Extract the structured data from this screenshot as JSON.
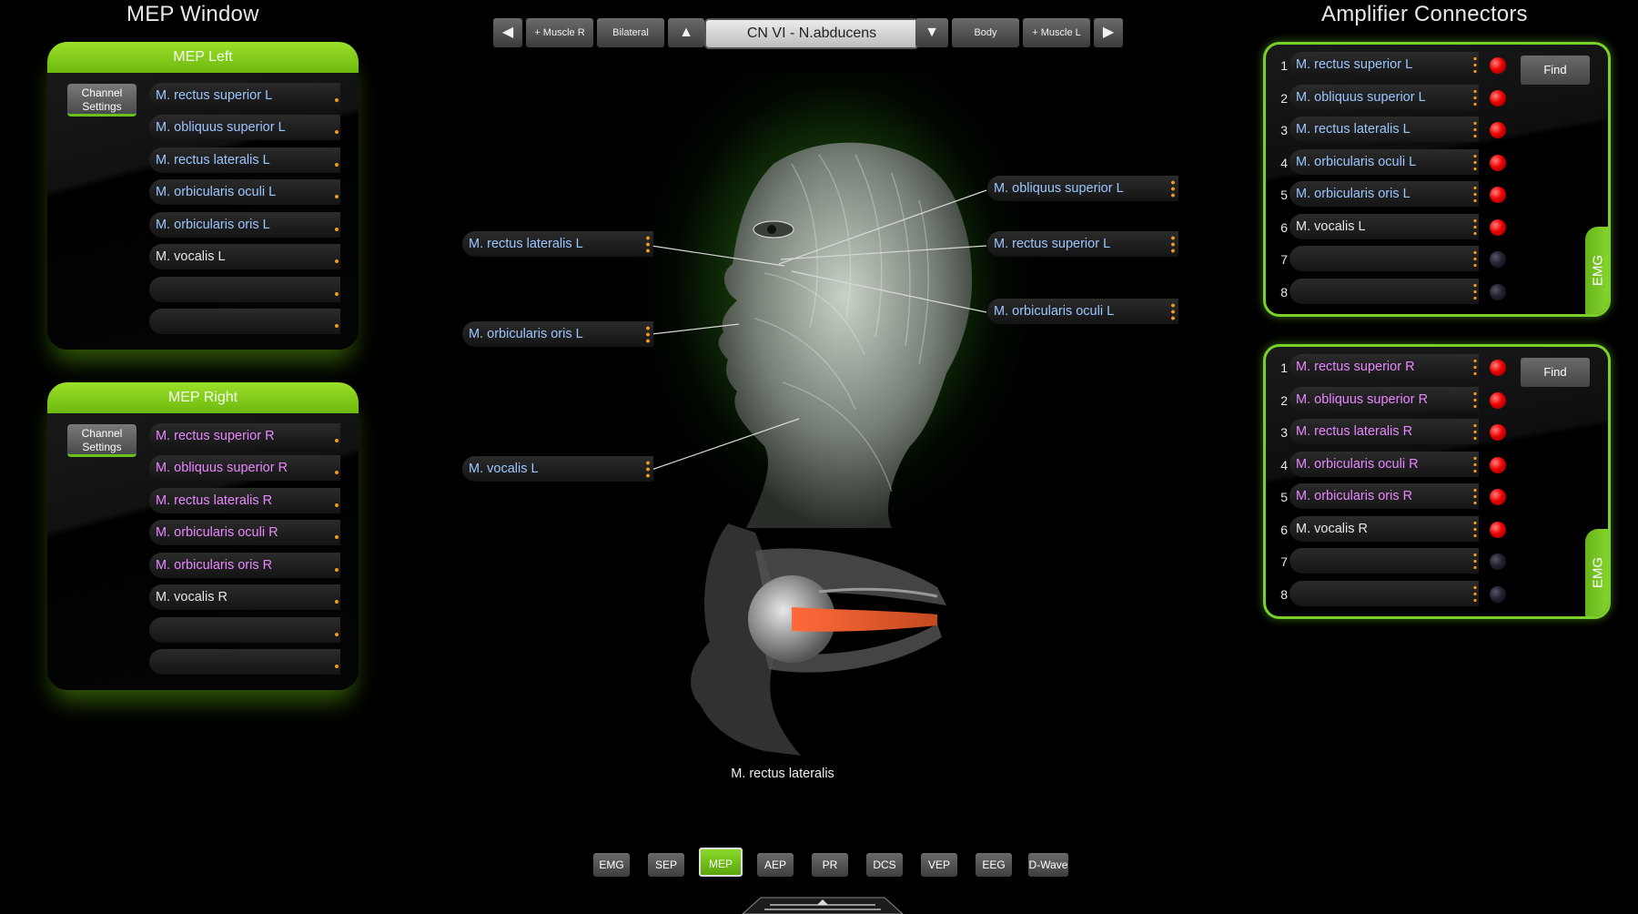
{
  "titles": {
    "mep_window": "MEP Window",
    "amplifier": "Amplifier Connectors"
  },
  "mep_left": {
    "header": "MEP Left",
    "channel_settings": "Channel Settings",
    "channels": [
      "M. rectus superior L",
      "M. obliquus superior L",
      "M. rectus lateralis L",
      "M. orbicularis oculi L",
      "M. orbicularis oris L",
      "M. vocalis L",
      "",
      ""
    ]
  },
  "mep_right": {
    "header": "MEP Right",
    "channel_settings": "Channel Settings",
    "channels": [
      "M. rectus superior R",
      "M. obliquus superior R",
      "M. rectus lateralis R",
      "M. orbicularis oculi R",
      "M. orbicularis oris R",
      "M. vocalis R",
      "",
      ""
    ]
  },
  "toolbar": {
    "prev_arrow": "◀",
    "muscle_r": "+ Muscle R",
    "bilateral": "Bilateral",
    "up_arrow": "▲",
    "nerve_select": "CN VI - N.abducens",
    "down_arrow": "▼",
    "body": "Body",
    "muscle_l": "+ Muscle L",
    "next_arrow": "▶"
  },
  "canvas": {
    "labels": {
      "rectus_lateralis": "M. rectus lateralis L",
      "orbicularis_oris": "M. orbicularis oris L",
      "vocalis": "M. vocalis L",
      "obliquus_superior": "M. obliquus superior L",
      "rectus_superior": "M. rectus superior L",
      "orbicularis_oculi": "M. orbicularis oculi L"
    },
    "eye_caption": "M. rectus lateralis"
  },
  "amp_left": {
    "find": "Find",
    "emg": "EMG",
    "rows": [
      {
        "num": "1",
        "label": "M. rectus superior L",
        "led": "on"
      },
      {
        "num": "2",
        "label": "M. obliquus superior L",
        "led": "on"
      },
      {
        "num": "3",
        "label": "M. rectus lateralis L",
        "led": "on"
      },
      {
        "num": "4",
        "label": "M. orbicularis oculi L",
        "led": "on"
      },
      {
        "num": "5",
        "label": "M. orbicularis oris L",
        "led": "on"
      },
      {
        "num": "6",
        "label": "M. vocalis L",
        "led": "on"
      },
      {
        "num": "7",
        "label": "",
        "led": "off"
      },
      {
        "num": "8",
        "label": "",
        "led": "off"
      }
    ]
  },
  "amp_right": {
    "find": "Find",
    "emg": "EMG",
    "rows": [
      {
        "num": "1",
        "label": "M. rectus superior R",
        "led": "on"
      },
      {
        "num": "2",
        "label": "M. obliquus superior R",
        "led": "on"
      },
      {
        "num": "3",
        "label": "M. rectus lateralis R",
        "led": "on"
      },
      {
        "num": "4",
        "label": "M. orbicularis oculi R",
        "led": "on"
      },
      {
        "num": "5",
        "label": "M. orbicularis oris R",
        "led": "on"
      },
      {
        "num": "6",
        "label": "M. vocalis R",
        "led": "on"
      },
      {
        "num": "7",
        "label": "",
        "led": "off"
      },
      {
        "num": "8",
        "label": "",
        "led": "off"
      }
    ]
  },
  "modes": {
    "active": "MEP",
    "tabs": [
      "EMG",
      "SEP",
      "MEP",
      "AEP",
      "PR",
      "DCS",
      "VEP",
      "EEG",
      "D-Wave"
    ]
  },
  "colors": {
    "accent_green": "#7ad02a",
    "left_text": "#9cc6ff",
    "right_text": "#e887ff",
    "led_on": "#e00000"
  }
}
